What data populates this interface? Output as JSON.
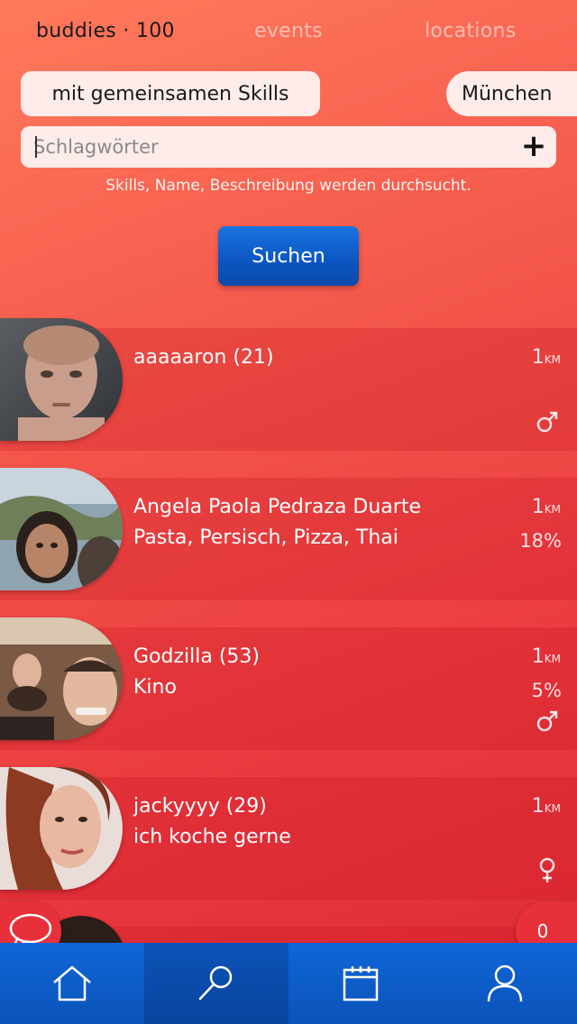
{
  "top_tabs": {
    "buddies": "buddies · 100",
    "events": "events",
    "locations": "locations"
  },
  "filters": {
    "skills_pill": "mit gemeinsamen Skills",
    "city_pill": "München"
  },
  "search": {
    "placeholder": "Schlagwörter",
    "value": "",
    "hint": "Skills, Name, Beschreibung werden durchsucht.",
    "button_label": "Suchen",
    "add_symbol": "+"
  },
  "results": [
    {
      "name": "aaaaaron (21)",
      "sub": "",
      "distance": "1",
      "unit": "KM",
      "match": "",
      "gender": "male"
    },
    {
      "name": "Angela Paola Pedraza Duarte",
      "sub": "Pasta, Persisch, Pizza, Thai",
      "distance": "1",
      "unit": "KM",
      "match": "18%",
      "gender": ""
    },
    {
      "name": "Godzilla (53)",
      "sub": "Kino",
      "distance": "1",
      "unit": "KM",
      "match": "5%",
      "gender": "male"
    },
    {
      "name": "jackyyyy (29)",
      "sub": "ich koche gerne",
      "distance": "1",
      "unit": "KM",
      "match": "",
      "gender": "female"
    }
  ],
  "fab": {
    "chat_icon": "chat-bubble-icon",
    "count": "0"
  },
  "bottom_nav": [
    {
      "icon": "home-icon",
      "active": false
    },
    {
      "icon": "search-icon",
      "active": true
    },
    {
      "icon": "calendar-icon",
      "active": false
    },
    {
      "icon": "profile-icon",
      "active": false
    }
  ],
  "colors": {
    "accent_blue": "#0b55c2",
    "background_red": "#ea3a3f",
    "pill_bg": "#fdecea"
  }
}
